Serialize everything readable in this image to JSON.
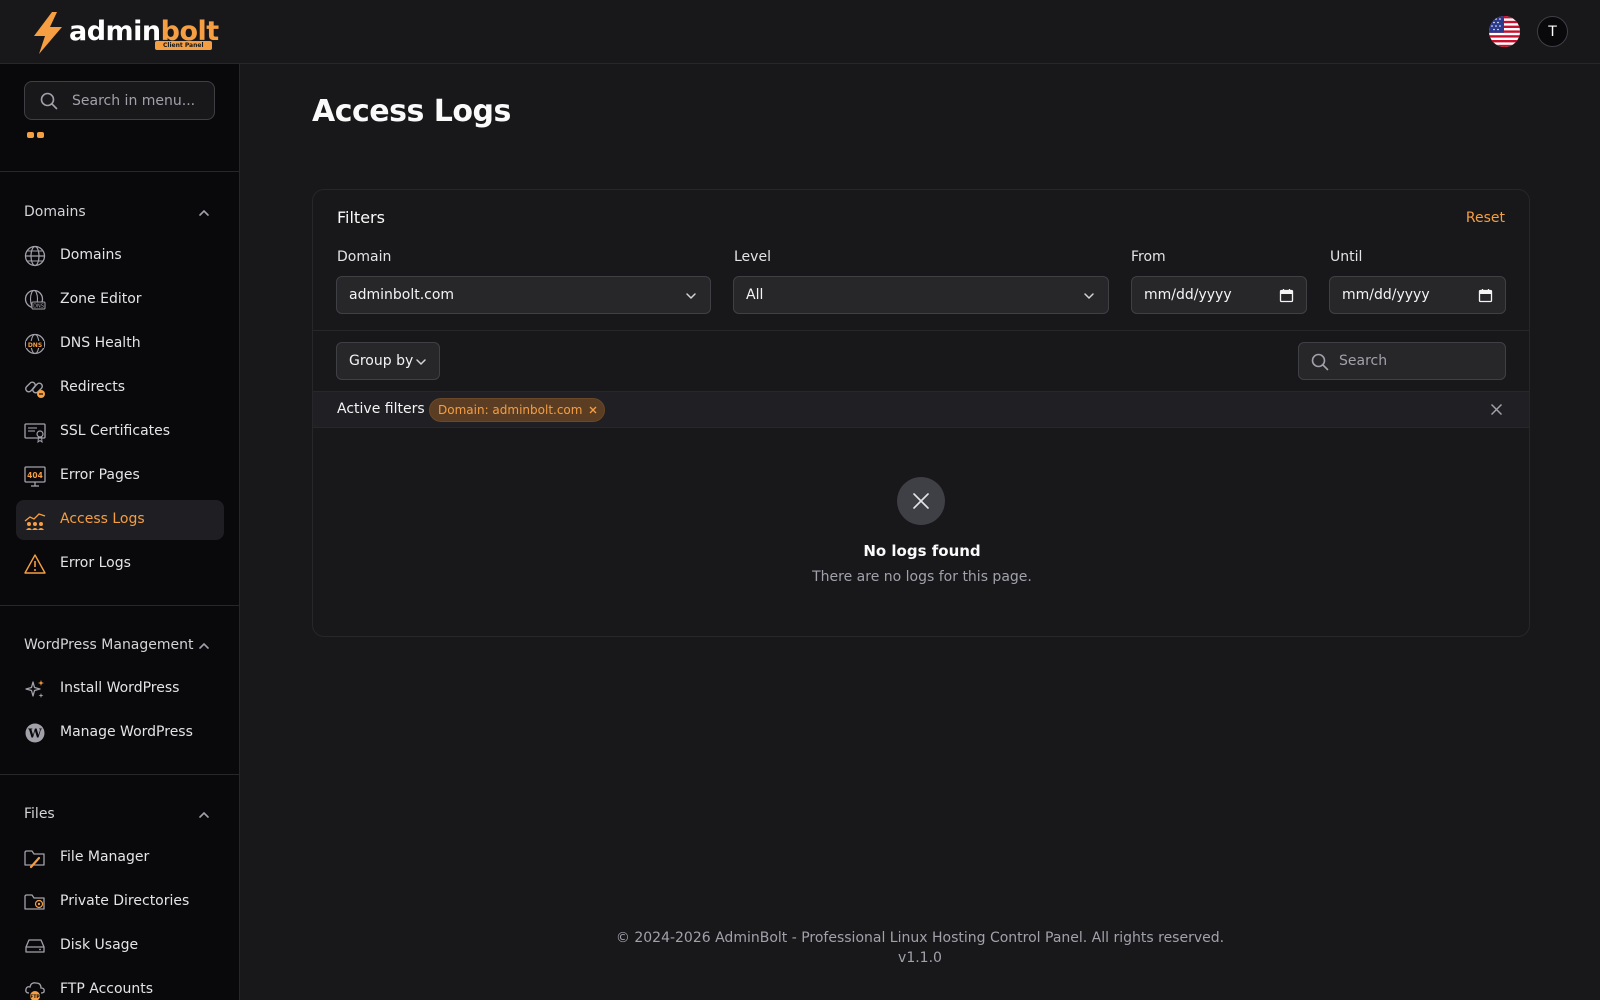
{
  "header": {
    "logo_word_1": "admin",
    "logo_word_2": "bolt",
    "logo_badge": "Client Panel",
    "avatar_initial": "T"
  },
  "sidebar": {
    "search_placeholder": "Search in menu...",
    "groups": [
      {
        "title": "Domains",
        "items": [
          {
            "label": "Domains",
            "icon": "globe-icon"
          },
          {
            "label": "Zone Editor",
            "icon": "dns-globe-icon"
          },
          {
            "label": "DNS Health",
            "icon": "dns-health-icon"
          },
          {
            "label": "Redirects",
            "icon": "link-icon"
          },
          {
            "label": "SSL Certificates",
            "icon": "certificate-icon"
          },
          {
            "label": "Error Pages",
            "icon": "error-404-icon"
          },
          {
            "label": "Access Logs",
            "icon": "access-logs-icon",
            "active": true
          },
          {
            "label": "Error Logs",
            "icon": "warning-icon"
          }
        ]
      },
      {
        "title": "WordPress Management",
        "items": [
          {
            "label": "Install WordPress",
            "icon": "sparkles-icon"
          },
          {
            "label": "Manage WordPress",
            "icon": "wordpress-icon"
          }
        ]
      },
      {
        "title": "Files",
        "items": [
          {
            "label": "File Manager",
            "icon": "folder-edit-icon"
          },
          {
            "label": "Private Directories",
            "icon": "folder-lock-icon"
          },
          {
            "label": "Disk Usage",
            "icon": "hard-drive-icon"
          },
          {
            "label": "FTP Accounts",
            "icon": "ftp-cloud-icon"
          }
        ]
      }
    ]
  },
  "main": {
    "title": "Access Logs",
    "filters": {
      "title": "Filters",
      "reset_label": "Reset",
      "domain_label": "Domain",
      "domain_value": "adminbolt.com",
      "level_label": "Level",
      "level_value": "All",
      "from_label": "From",
      "from_placeholder": "mm/dd/yyyy",
      "until_label": "Until",
      "until_placeholder": "mm/dd/yyyy"
    },
    "toolbar": {
      "group_by_label": "Group by",
      "search_placeholder": "Search"
    },
    "active_filters": {
      "label": "Active filters",
      "chips": [
        "Domain: adminbolt.com"
      ]
    },
    "empty_state": {
      "title": "No logs found",
      "subtitle": "There are no logs for this page."
    }
  },
  "footer": {
    "copyright": "© 2024-2026 AdminBolt - Professional Linux Hosting Control Panel. All rights reserved.",
    "version": "v1.1.0"
  },
  "colors": {
    "accent": "#f59e42",
    "background": "#18181b",
    "sidebar_background": "#09090b"
  }
}
